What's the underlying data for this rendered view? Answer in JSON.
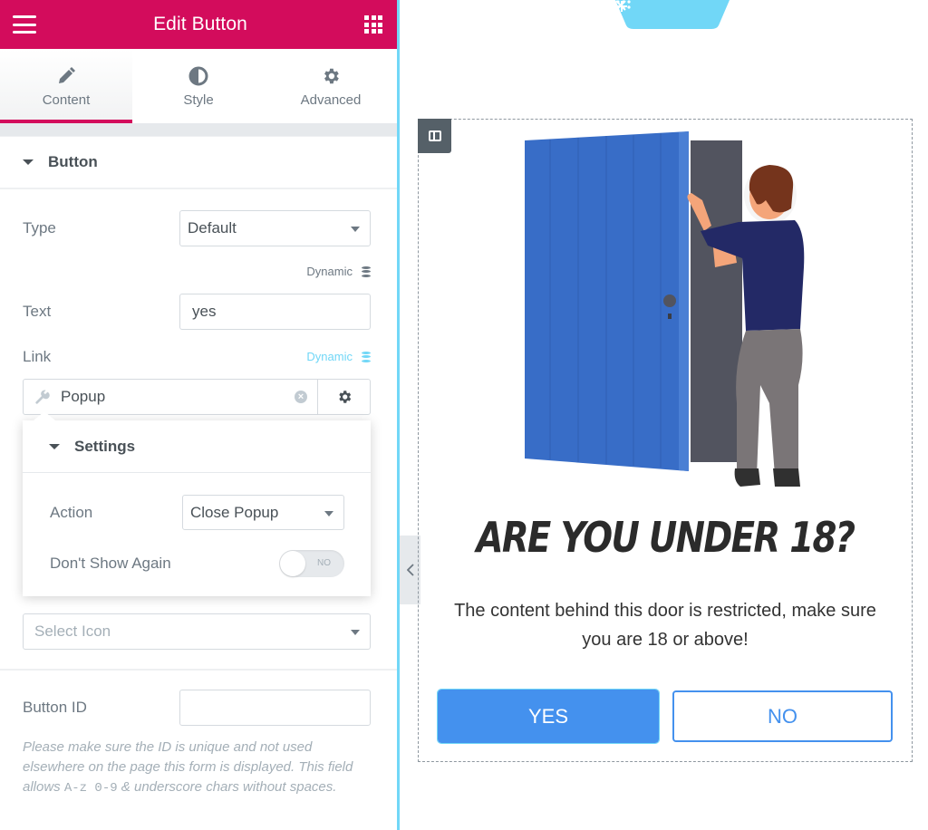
{
  "header": {
    "title": "Edit Button",
    "menu_icon": "hamburger-icon",
    "apps_icon": "grid-icon"
  },
  "tabs": [
    {
      "label": "Content",
      "icon": "pencil-icon",
      "active": true
    },
    {
      "label": "Style",
      "icon": "contrast-icon",
      "active": false
    },
    {
      "label": "Advanced",
      "icon": "gear-icon",
      "active": false
    }
  ],
  "section": {
    "title": "Button"
  },
  "controls": {
    "type": {
      "label": "Type",
      "value": "Default"
    },
    "type_dynamic": "Dynamic",
    "text": {
      "label": "Text",
      "value": "yes"
    },
    "link": {
      "label": "Link",
      "dynamic": "Dynamic",
      "value": "Popup"
    },
    "icon_select": {
      "placeholder": "Select Icon"
    },
    "button_id": {
      "label": "Button ID",
      "value": ""
    },
    "button_id_help_1": "Please make sure the ID is unique and not used elsewhere on the page this form is displayed. This field allows ",
    "button_id_help_code1": "A-z",
    "button_id_help_code2": "0-9",
    "button_id_help_2": " & underscore chars without spaces."
  },
  "settings_popover": {
    "title": "Settings",
    "action": {
      "label": "Action",
      "value": "Close Popup"
    },
    "dont_show_again": {
      "label": "Don't Show Again",
      "state": "NO",
      "on": false
    }
  },
  "canvas": {
    "toolbar": [
      "add-icon",
      "drag-handle-icon",
      "close-icon"
    ],
    "heading": "Are you under 18?",
    "subtext": "The content behind this door is restricted, make sure you are 18 or above!",
    "yes_button": "YES",
    "no_button": "NO"
  },
  "colors": {
    "brand": "#d30c5c",
    "accent_cyan": "#71d7f7",
    "button_blue": "#4491ee",
    "door_blue": "#386dc7"
  }
}
